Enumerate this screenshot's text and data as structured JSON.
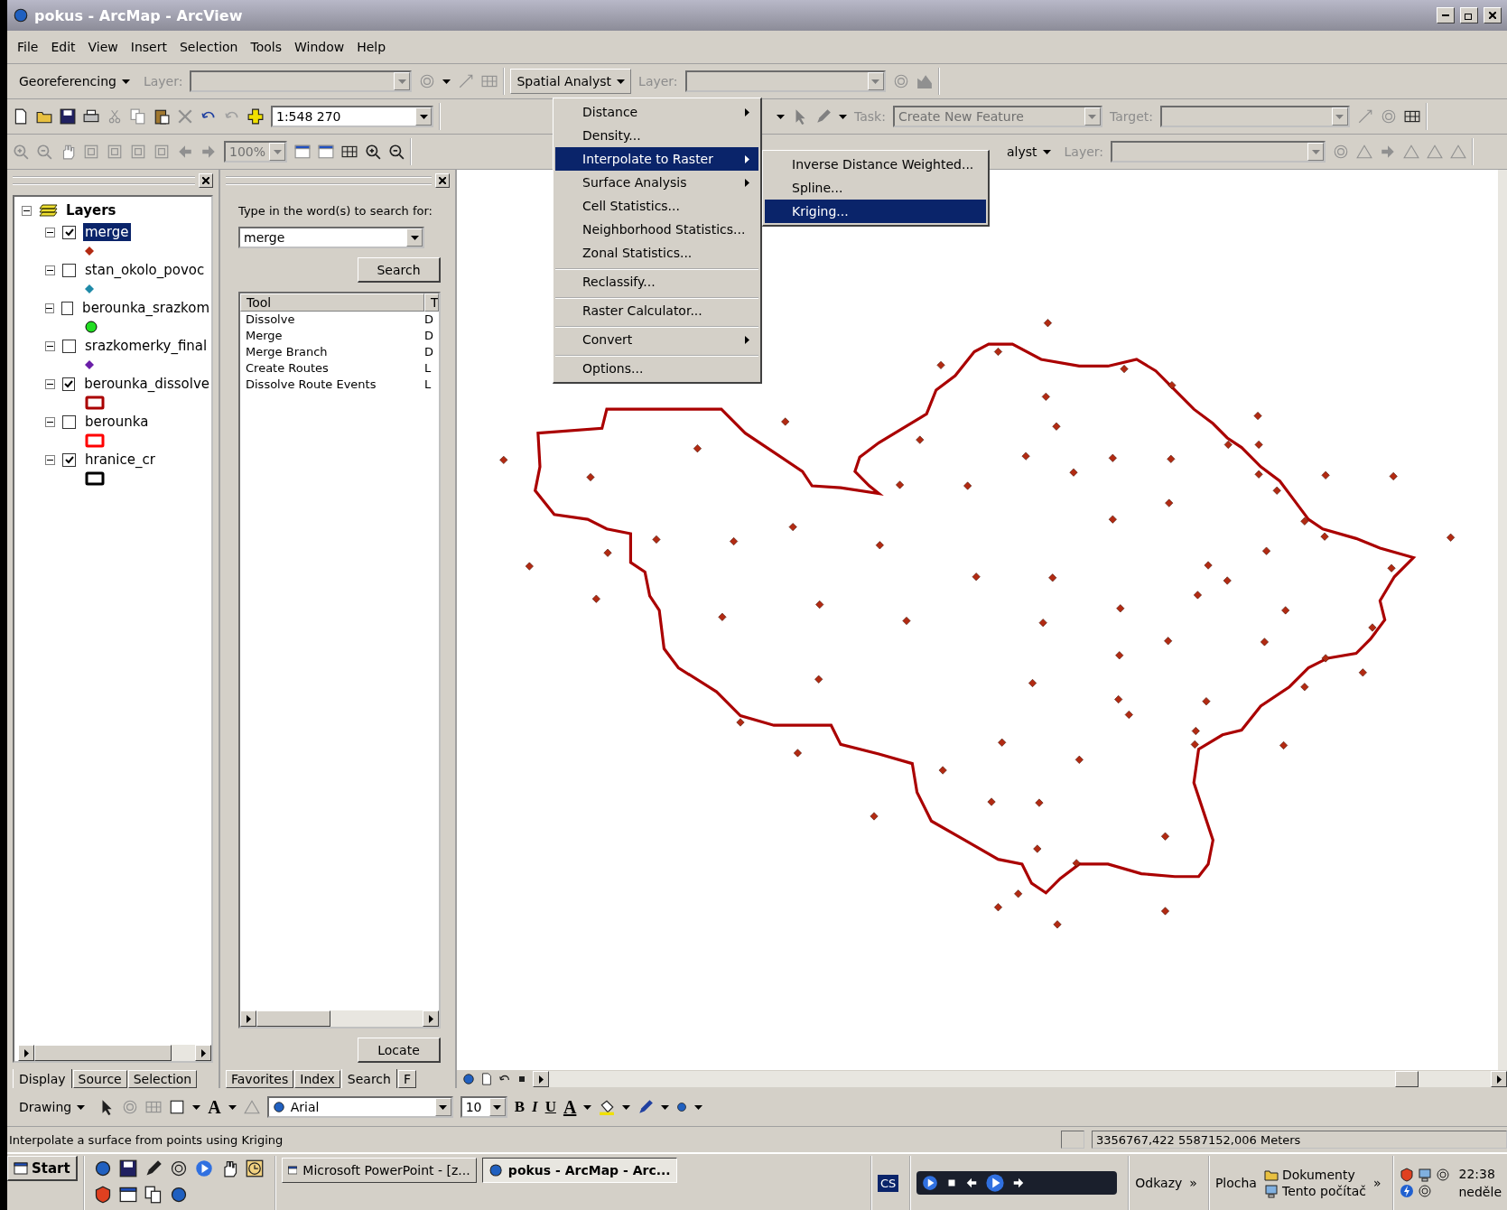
{
  "window": {
    "title": "pokus - ArcMap - ArcView"
  },
  "menu_bar": [
    "File",
    "Edit",
    "View",
    "Insert",
    "Selection",
    "Tools",
    "Window",
    "Help"
  ],
  "toolbar_georef": {
    "label": "Georeferencing",
    "layer_label": "Layer:"
  },
  "toolbar_spatial": {
    "label": "Spatial Analyst",
    "layer_label": "Layer:"
  },
  "standard_toolbar": {
    "scale": "1:548 270"
  },
  "editor_toolbar": {
    "task_label": "Task:",
    "task_value": "Create New Feature",
    "target_label": "Target:"
  },
  "tools_toolbar": {
    "zoom": "100%"
  },
  "toolbar_spatial_2": {
    "label": "alyst",
    "layer_label": "Layer:"
  },
  "spatial_menu": [
    {
      "label": "Distance",
      "submenu": true,
      "selected": false,
      "separator_before": false
    },
    {
      "label": "Density...",
      "submenu": false,
      "selected": false,
      "separator_before": false
    },
    {
      "label": "Interpolate to Raster",
      "submenu": true,
      "selected": true,
      "separator_before": false
    },
    {
      "label": "Surface Analysis",
      "submenu": true,
      "selected": false,
      "separator_before": false
    },
    {
      "label": "Cell Statistics...",
      "submenu": false,
      "selected": false,
      "separator_before": false
    },
    {
      "label": "Neighborhood Statistics...",
      "submenu": false,
      "selected": false,
      "separator_before": false
    },
    {
      "label": "Zonal Statistics...",
      "submenu": false,
      "selected": false,
      "separator_before": false
    },
    {
      "label": "Reclassify...",
      "submenu": false,
      "selected": false,
      "separator_before": true
    },
    {
      "label": "Raster Calculator...",
      "submenu": false,
      "selected": false,
      "separator_before": true
    },
    {
      "label": "Convert",
      "submenu": true,
      "selected": false,
      "separator_before": true
    },
    {
      "label": "Options...",
      "submenu": false,
      "selected": false,
      "separator_before": true
    }
  ],
  "interpolate_submenu": [
    {
      "label": "Inverse Distance Weighted...",
      "selected": false
    },
    {
      "label": "Spline...",
      "selected": false
    },
    {
      "label": "Kriging...",
      "selected": true
    }
  ],
  "toc": {
    "root": {
      "label": "Layers",
      "expanded": true,
      "children": [
        {
          "label": "merge",
          "checked": true,
          "selected": true,
          "expanded": true,
          "symbol": {
            "kind": "diamond",
            "color": "#b22a12"
          }
        },
        {
          "label": "stan_okolo_povoc",
          "checked": false,
          "selected": false,
          "expanded": true,
          "symbol": {
            "kind": "diamond",
            "color": "#1f8aa8"
          }
        },
        {
          "label": "berounka_srazkom",
          "checked": false,
          "selected": false,
          "expanded": true,
          "symbol": {
            "kind": "circle",
            "color": "#22dd22"
          }
        },
        {
          "label": "srazkomerky_final",
          "checked": false,
          "selected": false,
          "expanded": true,
          "symbol": {
            "kind": "diamond",
            "color": "#6a1ea8"
          }
        },
        {
          "label": "berounka_dissolve",
          "checked": true,
          "selected": false,
          "expanded": true,
          "symbol": {
            "kind": "polygon",
            "color": "#aa0000"
          }
        },
        {
          "label": "berounka",
          "checked": false,
          "selected": false,
          "expanded": true,
          "symbol": {
            "kind": "polygon",
            "color": "#ff0000"
          }
        },
        {
          "label": "hranice_cr",
          "checked": true,
          "selected": false,
          "expanded": true,
          "symbol": {
            "kind": "polygon",
            "color": "#000000"
          }
        }
      ]
    },
    "tabs": [
      {
        "label": "Display",
        "selected": true
      },
      {
        "label": "Source",
        "selected": false
      },
      {
        "label": "Selection",
        "selected": false
      }
    ]
  },
  "search_panel": {
    "prompt": "Type in the word(s) to search for:",
    "query": "merge",
    "search_button": "Search",
    "columns": [
      "Tool",
      "T"
    ],
    "rows": [
      [
        "Dissolve",
        "D"
      ],
      [
        "Merge",
        "D"
      ],
      [
        "Merge Branch",
        "D"
      ],
      [
        "Create Routes",
        "L"
      ],
      [
        "Dissolve Route Events",
        "L"
      ]
    ],
    "locate_button": "Locate",
    "tabs": [
      {
        "label": "Favorites",
        "selected": false
      },
      {
        "label": "Index",
        "selected": false
      },
      {
        "label": "Search",
        "selected": true
      },
      {
        "label": "F",
        "selected": false
      }
    ]
  },
  "drawing_toolbar": {
    "label": "Drawing",
    "text_tool": "A",
    "font": "Arial",
    "size": "10",
    "bold": "B",
    "italic": "I",
    "underline": "U",
    "font_color": "A"
  },
  "status_bar": {
    "message": "Interpolate a surface from points using Kriging",
    "coordinates": "3356767,422  5587152,006 Meters"
  },
  "taskbar": {
    "start": "Start",
    "tasks": [
      {
        "label": "Microsoft PowerPoint - [z...",
        "selected": false
      },
      {
        "label": "pokus - ArcMap - Arc...",
        "selected": true
      }
    ],
    "language": "CS",
    "links": "Odkazy",
    "links_more": "»",
    "desktop": "Plocha",
    "documents": "Dokumenty",
    "computer": "Tento počítač",
    "more": "»",
    "time": "22:38",
    "day": "neděle"
  }
}
